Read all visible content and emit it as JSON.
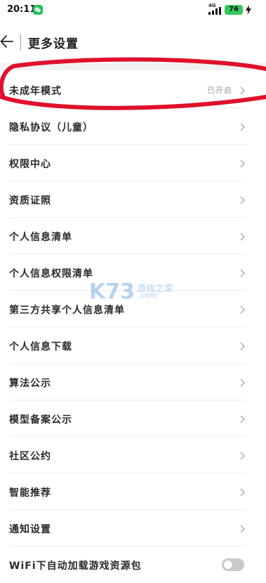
{
  "status_bar": {
    "time": "20:11",
    "network": "4G",
    "battery": "76"
  },
  "header": {
    "title": "更多设置"
  },
  "settings": {
    "items": [
      {
        "label": "未成年模式",
        "value": "已开启"
      },
      {
        "label": "隐私协议（儿童）"
      },
      {
        "label": "权限中心"
      },
      {
        "label": "资质证照"
      },
      {
        "label": "个人信息清单"
      },
      {
        "label": "个人信息权限清单"
      },
      {
        "label": "第三方共享个人信息清单"
      },
      {
        "label": "个人信息下载"
      },
      {
        "label": "算法公示"
      },
      {
        "label": "模型备案公示"
      },
      {
        "label": "社区公约"
      },
      {
        "label": "智能推荐"
      },
      {
        "label": "通知设置"
      }
    ],
    "wifi_toggle": {
      "label": "WiFi下自动加载游戏资源包",
      "on": false
    }
  },
  "watermark": {
    "logo": "K73",
    "text": "游戏之家",
    "domain": ".com"
  },
  "colors": {
    "highlight": "#e0102a",
    "battery": "#34c759",
    "wechat": "#22c05c"
  }
}
